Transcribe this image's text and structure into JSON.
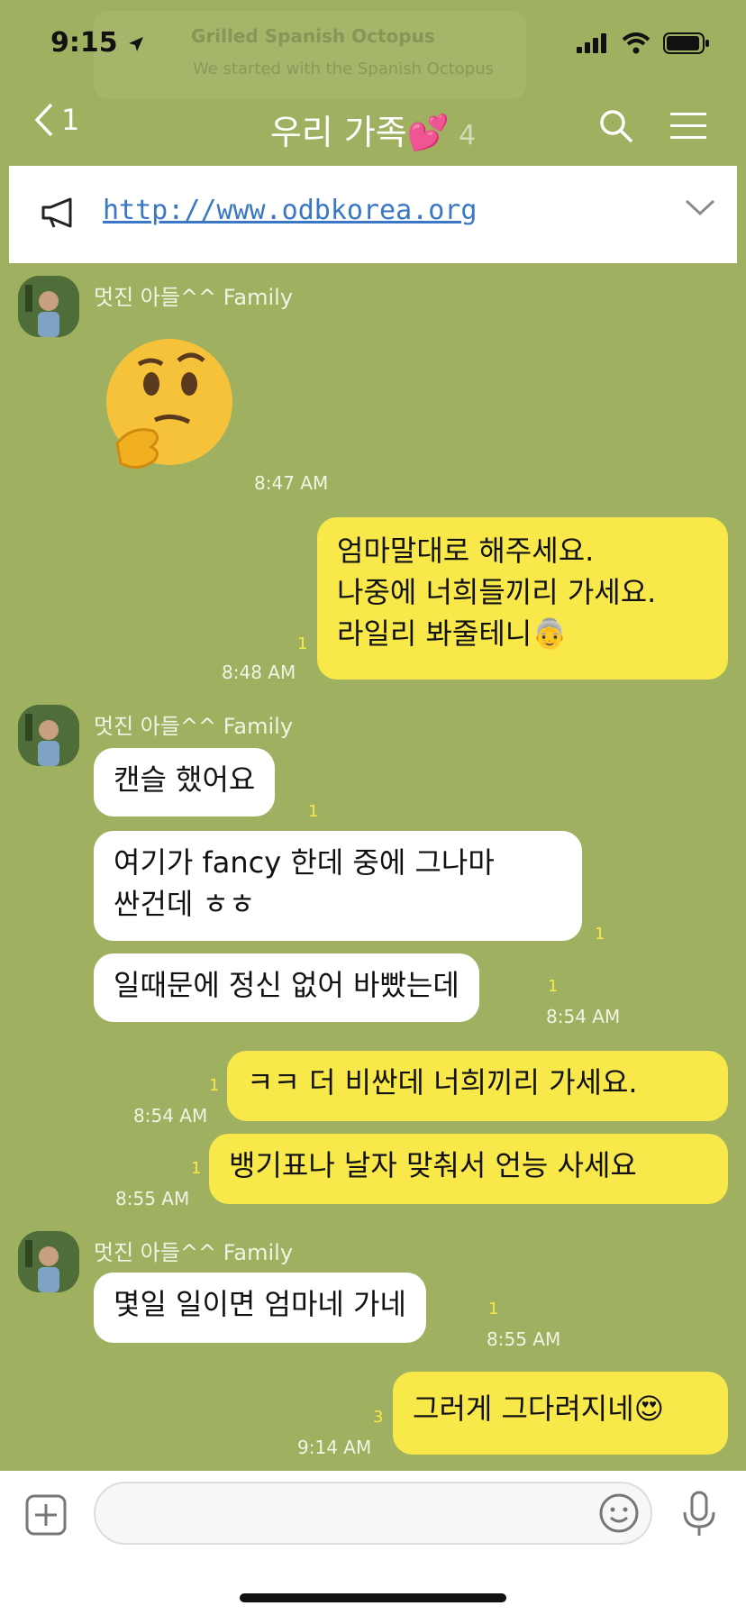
{
  "status": {
    "time": "9:15"
  },
  "ghost_notification": {
    "title": "Grilled Spanish Octopus",
    "subtitle": "We started with the Spanish Octopus"
  },
  "header": {
    "back_count": "1",
    "title": "우리 가족💕",
    "member_count": "4"
  },
  "notice": {
    "link": "http://www.odbkorea.org"
  },
  "messages": [
    {
      "sender": "멋진 아들^^ Family",
      "time": "8:47 AM"
    },
    {
      "text_lines": [
        "엄마말대로 해주세요.",
        "나중에 너희들끼리 가세요.",
        "라일리 봐줄테니👵"
      ],
      "read": "1",
      "time": "8:48 AM"
    },
    {
      "sender": "멋진 아들^^ Family",
      "text": "캔슬 했어요",
      "read": "1"
    },
    {
      "text_lines": [
        "여기가 fancy 한데 중에 그나마",
        "싼건데 ㅎㅎ"
      ],
      "read": "1"
    },
    {
      "text": "일때문에 정신 없어 바빴는데",
      "read": "1",
      "time": "8:54 AM"
    },
    {
      "text": "ㅋㅋ 더 비싼데 너희끼리 가세요.",
      "read": "1",
      "time": "8:54 AM"
    },
    {
      "text": "뱅기표나 날자 맞춰서 언능 사세요",
      "read": "1",
      "time": "8:55 AM"
    },
    {
      "sender": "멋진 아들^^ Family",
      "text": "몇일 일이면 엄마네 가네",
      "read": "1",
      "time": "8:55 AM"
    },
    {
      "text": "그러게 그다려지네😍",
      "read": "3",
      "time": "9:14 AM"
    }
  ],
  "colors": {
    "chat_bg": "#9fb060",
    "out_bubble": "#f8e84a",
    "in_bubble": "#ffffff",
    "read_count": "#f7e94a",
    "link": "#3a77c4"
  },
  "icons": [
    "signal-icon",
    "wifi-icon",
    "battery-icon",
    "location-arrow-icon",
    "back-chevron-icon",
    "search-icon",
    "menu-icon",
    "megaphone-icon",
    "chevron-down-icon",
    "thinking-face-icon",
    "plus-icon",
    "emoji-icon",
    "microphone-icon"
  ]
}
